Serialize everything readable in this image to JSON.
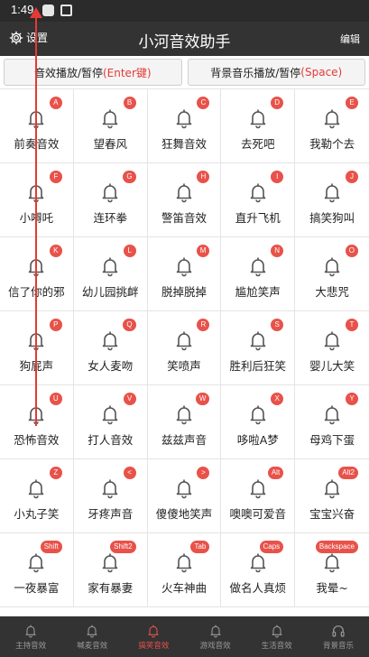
{
  "status_bar": {
    "time": "1:49"
  },
  "app_bar": {
    "settings_label": "设置",
    "title": "小河音效助手",
    "edit_label": "编辑"
  },
  "controls": {
    "sfx": {
      "text": "音效播放/暂停",
      "key": "(Enter键)"
    },
    "bgm": {
      "text": "背景音乐播放/暂停",
      "key": "(Space)"
    }
  },
  "sounds": [
    {
      "label": "前奏音效",
      "key": "A"
    },
    {
      "label": "望春风",
      "key": "B"
    },
    {
      "label": "狂舞音效",
      "key": "C"
    },
    {
      "label": "去死吧",
      "key": "D"
    },
    {
      "label": "我勒个去",
      "key": "E"
    },
    {
      "label": "小嘚吒",
      "key": "F"
    },
    {
      "label": "连环拳",
      "key": "G"
    },
    {
      "label": "警笛音效",
      "key": "H"
    },
    {
      "label": "直升飞机",
      "key": "I"
    },
    {
      "label": "搞笑狗叫",
      "key": "J"
    },
    {
      "label": "信了你的邪",
      "key": "K"
    },
    {
      "label": "幼儿园挑衅",
      "key": "L"
    },
    {
      "label": "脱掉脱掉",
      "key": "M"
    },
    {
      "label": "尴尬笑声",
      "key": "N"
    },
    {
      "label": "大悲咒",
      "key": "O"
    },
    {
      "label": "狗屁声",
      "key": "P"
    },
    {
      "label": "女人麦吻",
      "key": "Q"
    },
    {
      "label": "笑喷声",
      "key": "R"
    },
    {
      "label": "胜利后狂笑",
      "key": "S"
    },
    {
      "label": "婴儿大笑",
      "key": "T"
    },
    {
      "label": "恐怖音效",
      "key": "U"
    },
    {
      "label": "打人音效",
      "key": "V"
    },
    {
      "label": "兹兹声音",
      "key": "W"
    },
    {
      "label": "哆啦A梦",
      "key": "X"
    },
    {
      "label": "母鸡下蛋",
      "key": "Y"
    },
    {
      "label": "小丸子笑",
      "key": "Z"
    },
    {
      "label": "牙疼声音",
      "key": "<"
    },
    {
      "label": "傻傻地笑声",
      "key": ">"
    },
    {
      "label": "噢噢可爱音",
      "key": "Alt"
    },
    {
      "label": "宝宝兴奋",
      "key": "Alt2"
    },
    {
      "label": "一夜暴富",
      "key": "Shift"
    },
    {
      "label": "家有暴妻",
      "key": "Shift2"
    },
    {
      "label": "火车神曲",
      "key": "Tab"
    },
    {
      "label": "做名人真烦",
      "key": "Caps"
    },
    {
      "label": "我晕~",
      "key": "Backspace"
    }
  ],
  "bottom_nav": [
    {
      "label": "主持音效",
      "icon": "bell-icon",
      "active": false
    },
    {
      "label": "喊麦音效",
      "icon": "bell-icon",
      "active": false
    },
    {
      "label": "搞笑音效",
      "icon": "bell-icon",
      "active": true
    },
    {
      "label": "游戏音效",
      "icon": "bell-icon",
      "active": false
    },
    {
      "label": "生活音效",
      "icon": "bell-icon",
      "active": false
    },
    {
      "label": "背景音乐",
      "icon": "headphones-icon",
      "active": false
    }
  ],
  "colors": {
    "accent": "#e8524a",
    "app_bar": "#333333",
    "annotation_line": "#e53935"
  }
}
